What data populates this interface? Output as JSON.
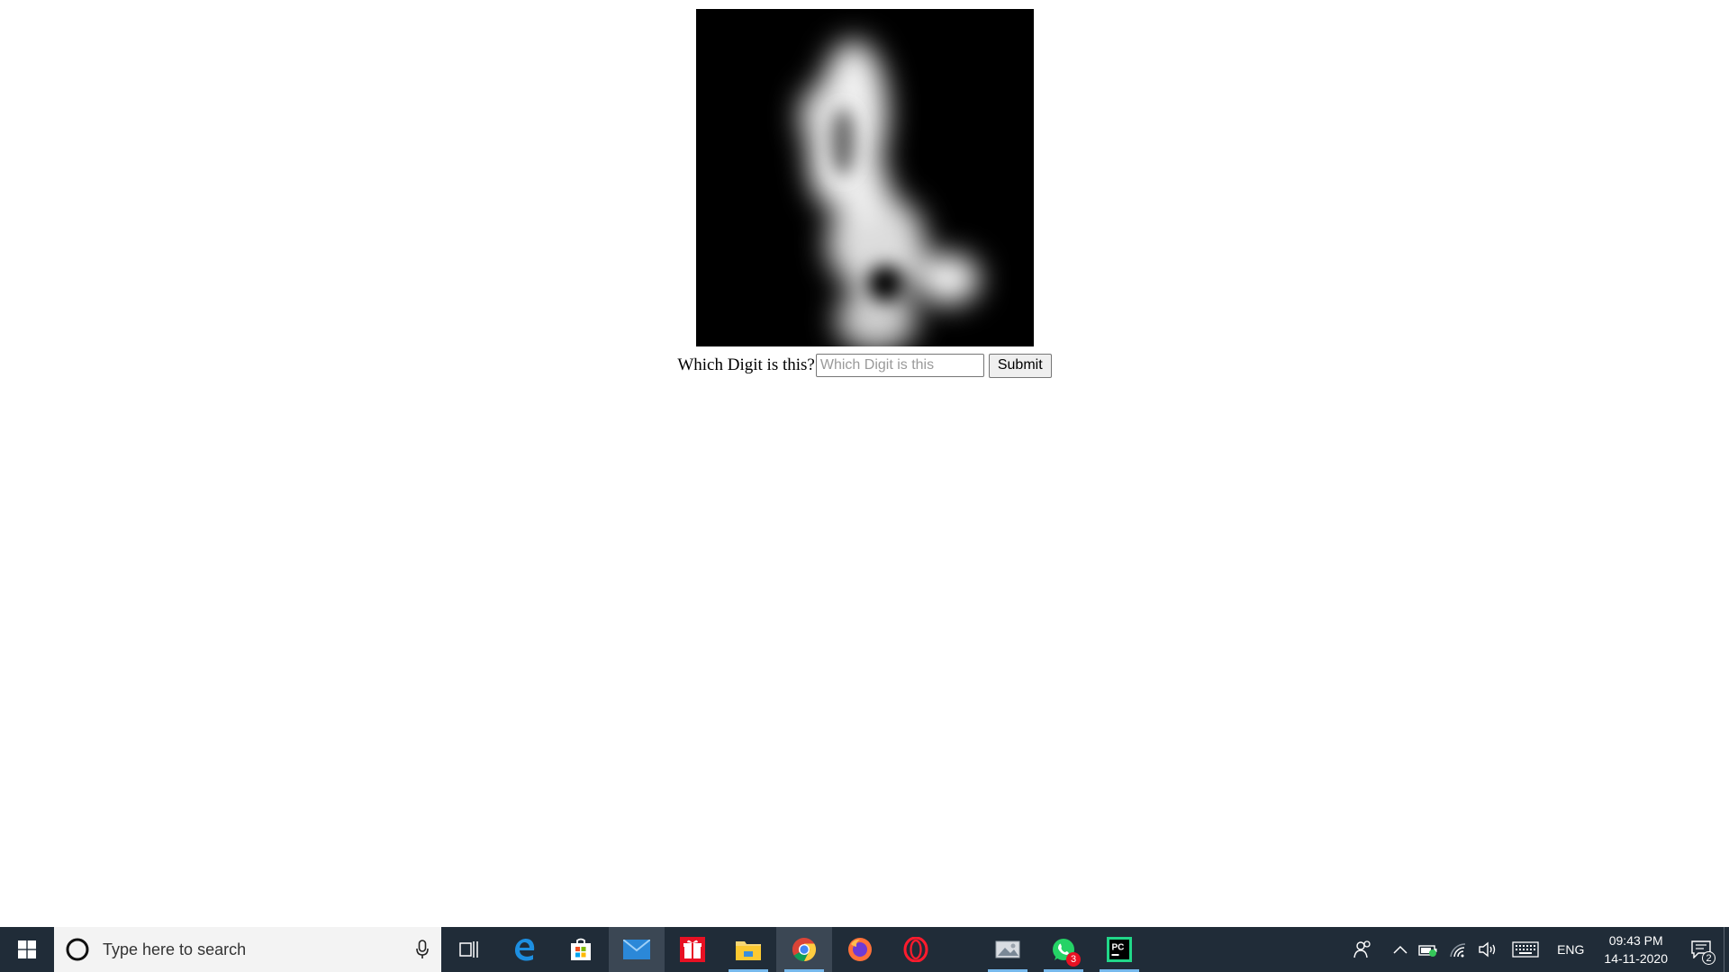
{
  "question": {
    "label": "Which Digit is this?",
    "input_placeholder": "Which Digit is this",
    "input_value": "",
    "submit_label": "Submit"
  },
  "taskbar": {
    "search_placeholder": "Type here to search",
    "apps": [
      {
        "name": "task-view-icon"
      },
      {
        "name": "edge-icon"
      },
      {
        "name": "store-icon"
      },
      {
        "name": "mail-icon",
        "active": true
      },
      {
        "name": "gift-icon"
      },
      {
        "name": "file-explorer-icon",
        "running": true
      },
      {
        "name": "chrome-icon",
        "running": true,
        "active": true
      },
      {
        "name": "firefox-icon"
      },
      {
        "name": "opera-icon"
      },
      {
        "name": "photos-icon",
        "running": true
      },
      {
        "name": "whatsapp-icon",
        "running": true,
        "badge": "3"
      },
      {
        "name": "pycharm-icon",
        "running": true
      }
    ],
    "tray": {
      "language": "ENG",
      "time": "09:43 PM",
      "date": "14-11-2020",
      "notifications": "2"
    }
  },
  "colors": {
    "taskbar_bg": "#202c38",
    "accent": "#76b9ed"
  }
}
